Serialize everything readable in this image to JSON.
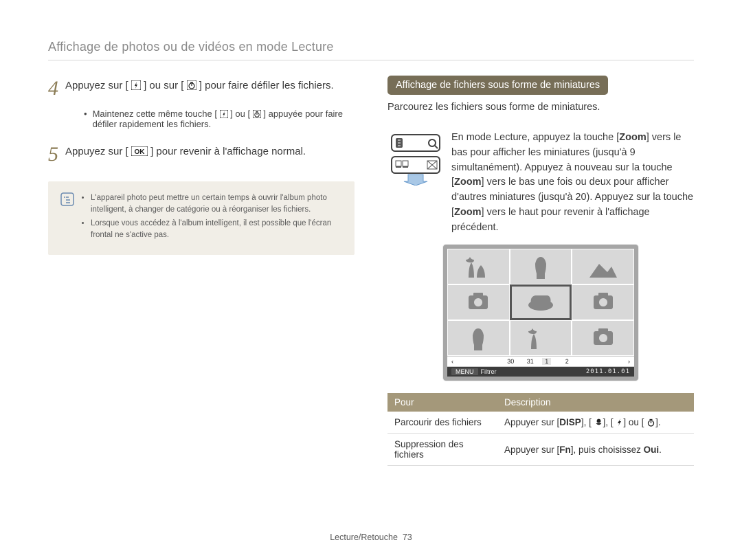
{
  "header": {
    "title": "Affichage de photos ou de vidéos en mode Lecture"
  },
  "left": {
    "step4": {
      "num": "4",
      "pre": "Appuyez sur [",
      "mid": "] ou sur [",
      "post": "] pour faire défiler les fichiers."
    },
    "step4_sub": {
      "pre": "Maintenez cette même touche [",
      "mid": "] ou [",
      "post": "] appuyée pour faire défiler rapidement les fichiers."
    },
    "step5": {
      "num": "5",
      "pre": "Appuyez sur [",
      "post": "] pour revenir à l'affichage normal."
    },
    "note": {
      "items": [
        "L'appareil photo peut mettre un certain temps à ouvrir l'album photo intelligent, à changer de catégorie ou à réorganiser les fichiers.",
        "Lorsque vous accédez à l'album intelligent, il est possible que l'écran frontal ne s'active pas."
      ]
    }
  },
  "right": {
    "pill": "Affichage de fichiers sous forme de miniatures",
    "intro": "Parcourez les fichiers sous forme de miniatures.",
    "zoom": {
      "p1_pre": "En mode Lecture, appuyez la touche [",
      "p1_post": "] vers le bas pour afficher les miniatures (jusqu'à 9 simultanément). Appuyez à nouveau sur la touche [",
      "p2_post": "] vers le bas une fois ou deux pour afficher d'autres miniatures (jusqu'à 20). Appuyez sur la touche [",
      "p3_post": "] vers le haut pour revenir à l'affichage précédent.",
      "zoom_label": "Zoom"
    },
    "thumb_bar": {
      "nums": [
        "30",
        "31",
        "1",
        "2"
      ],
      "menu": "MENU",
      "filter": "Filtrer",
      "date": "2011.01.01"
    },
    "table": {
      "head": {
        "c1": "Pour",
        "c2": "Description"
      },
      "rows": [
        {
          "c1": "Parcourir des fichiers",
          "pre": "Appuyer sur [",
          "sep": "], [",
          "sep2": "], [",
          "sep3": "] ou [",
          "post": "].",
          "disp": "DISP"
        },
        {
          "c1": "Suppression des fichiers",
          "pre": "Appuyer sur [",
          "fn": "Fn",
          "mid": "], puis choisissez ",
          "oui": "Oui",
          "post": "."
        }
      ]
    }
  },
  "footer": {
    "section": "Lecture/Retouche",
    "page": "73"
  }
}
